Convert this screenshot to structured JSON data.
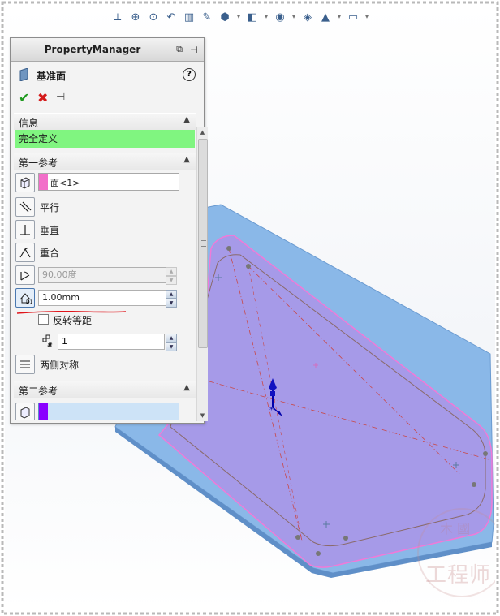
{
  "property_manager": {
    "title": "PropertyManager",
    "feature_name": "基准面",
    "help_glyph": "?",
    "ok_glyph": "✔",
    "cancel_glyph": "✖",
    "pin_glyph": "⊣"
  },
  "info_section": {
    "title": "信息",
    "status": "完全定义",
    "status_color": "#80f580"
  },
  "first_reference": {
    "title": "第一参考",
    "selection_value": "面<1>",
    "selection_swatch_color": "#f26fc9",
    "options": {
      "parallel": "平行",
      "perpendicular": "垂直",
      "coincident": "重合",
      "angle_value": "90.00度",
      "distance_value": "1.00mm",
      "flip_label": "反转等距",
      "instance_count": "1",
      "mid_plane": "两侧对称"
    }
  },
  "second_reference": {
    "title": "第二参考",
    "selection_swatch_color": "#8a00ff"
  },
  "watermark": {
    "top": "木 國",
    "bottom": "工程师"
  },
  "toolbar": {
    "icons": [
      "view-orientation-icon",
      "zoom-fit-icon",
      "zoom-area-icon",
      "previous-view-icon",
      "section-view-icon",
      "dynamic-annotation-icon",
      "view-orientation-cube-icon",
      "display-style-icon",
      "hide-show-icon",
      "edit-appearance-icon",
      "apply-scene-icon",
      "view-settings-icon"
    ]
  },
  "colors": {
    "part_face": "#a69ae8",
    "part_edge": "#7ab7ec",
    "plane_outline": "#f07ad8",
    "accent_red": "#e0151b"
  }
}
